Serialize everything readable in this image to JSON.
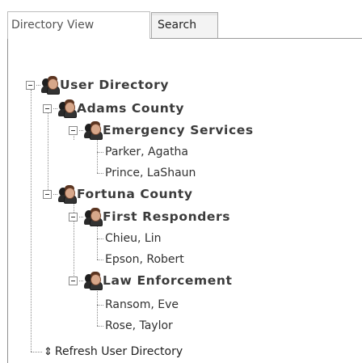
{
  "tabs": [
    {
      "label": "Directory View",
      "active": true
    },
    {
      "label": "Search",
      "active": false
    }
  ],
  "tree": {
    "root": {
      "label": "User Directory",
      "icon": "users-icon",
      "children": [
        {
          "label": "Adams County",
          "groups": [
            {
              "label": "Emergency Services",
              "members": [
                "Parker, Agatha",
                "Prince, LaShaun"
              ]
            }
          ]
        },
        {
          "label": "Fortuna County",
          "groups": [
            {
              "label": "First Responders",
              "members": [
                "Chieu, Lin",
                "Epson, Robert"
              ]
            },
            {
              "label": "Law Enforcement",
              "members": [
                "Ransom, Eve",
                "Rose, Taylor"
              ]
            }
          ]
        }
      ]
    },
    "refresh_label": "Refresh User Directory",
    "refresh_icon": "up-down-arrow-icon"
  }
}
